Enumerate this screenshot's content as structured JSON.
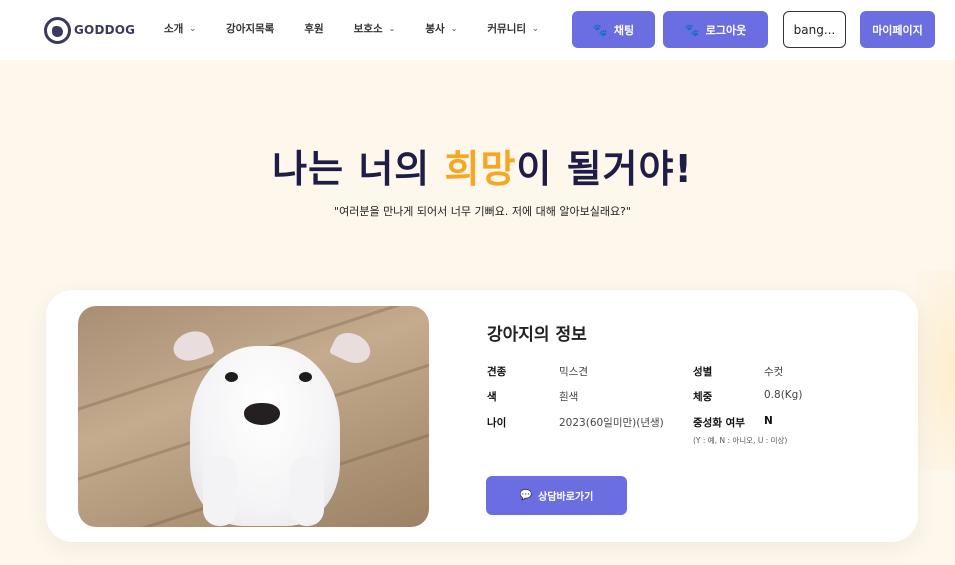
{
  "nav": {
    "logo_text": "GODDOG",
    "menu": [
      {
        "label": "소개",
        "dropdown": true
      },
      {
        "label": "강아지목록",
        "dropdown": false
      },
      {
        "label": "후원",
        "dropdown": false
      },
      {
        "label": "보호소",
        "dropdown": true
      },
      {
        "label": "봉사",
        "dropdown": true
      },
      {
        "label": "커뮤니티",
        "dropdown": true
      }
    ],
    "chat_label": "채팅",
    "logout_label": "로그아웃",
    "user_label": "bang...",
    "mypage_label": "마이페이지"
  },
  "hero": {
    "title_before": "나는 너의 ",
    "title_accent": "희망",
    "title_after": "이 될거야!",
    "subtitle": "\"여러분을 만나게 되어서 너무 기뻐요. 저에 대해 알아보실래요?\""
  },
  "dog_info": {
    "section_title": "강아지의 정보",
    "breed_label": "견종",
    "breed_value": "믹스견",
    "gender_label": "성별",
    "gender_value": "수컷",
    "color_label": "색",
    "color_value": "흰색",
    "weight_label": "체중",
    "weight_value": "0.8(Kg)",
    "age_label": "나이",
    "age_value": "2023(60일미만)(년생)",
    "neutered_label": "중성화 여부",
    "neutered_value": "N",
    "neutered_note": "(Y : 예, N : 아니오, U : 미상)",
    "consult_button": "상담바로가기"
  },
  "colors": {
    "accent": "#6a6ee0",
    "highlight": "#f5a623",
    "title": "#1f1d45",
    "background": "#fdf7ec"
  },
  "icons": {
    "logo": "dog-logo-icon",
    "chat": "paw-icon",
    "logout": "paw-icon",
    "consult": "speech-bubble-icon",
    "dropdown": "chevron-down-icon"
  }
}
